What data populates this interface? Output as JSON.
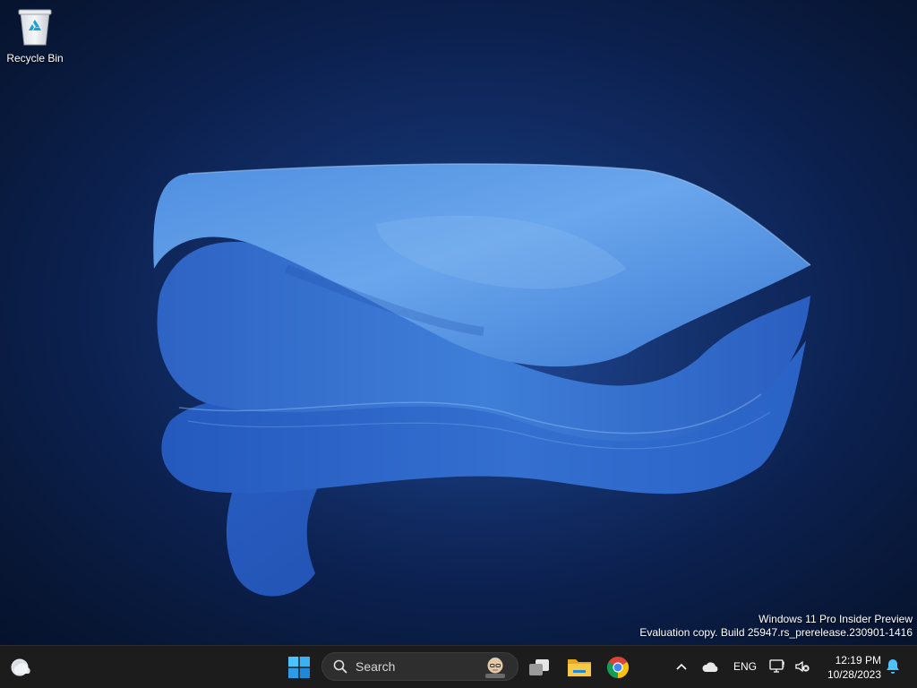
{
  "desktop": {
    "icons": [
      {
        "label": "Recycle Bin",
        "icon": "recycle-bin-icon"
      }
    ],
    "watermark": {
      "line1": "Windows 11 Pro Insider Preview",
      "line2": "Evaluation copy. Build 25947.rs_prerelease.230901-1416"
    },
    "colors": {
      "background": "#0c2150",
      "bloom": "#3a7bd5"
    }
  },
  "taskbar": {
    "weather_icon": "weather-cloud-icon",
    "start_icon": "windows-start-icon",
    "search": {
      "placeholder": "Search",
      "icon": "search-icon",
      "highlight_icon": "search-highlight-avatar-icon"
    },
    "apps": [
      {
        "name": "Task View",
        "icon": "task-view-icon"
      },
      {
        "name": "File Explorer",
        "icon": "folder-icon"
      },
      {
        "name": "Google Chrome",
        "icon": "chrome-icon"
      }
    ],
    "tray": {
      "overflow_icon": "chevron-up-icon",
      "onedrive_icon": "onedrive-cloud-icon",
      "language": "ENG",
      "network_icon": "network-icon",
      "volume_icon": "volume-muted-icon",
      "time": "12:19 PM",
      "date": "10/28/2023",
      "notification_icon": "bell-icon"
    },
    "colors": {
      "background": "#1c1c1c",
      "accent": "#4cc2ff"
    }
  }
}
